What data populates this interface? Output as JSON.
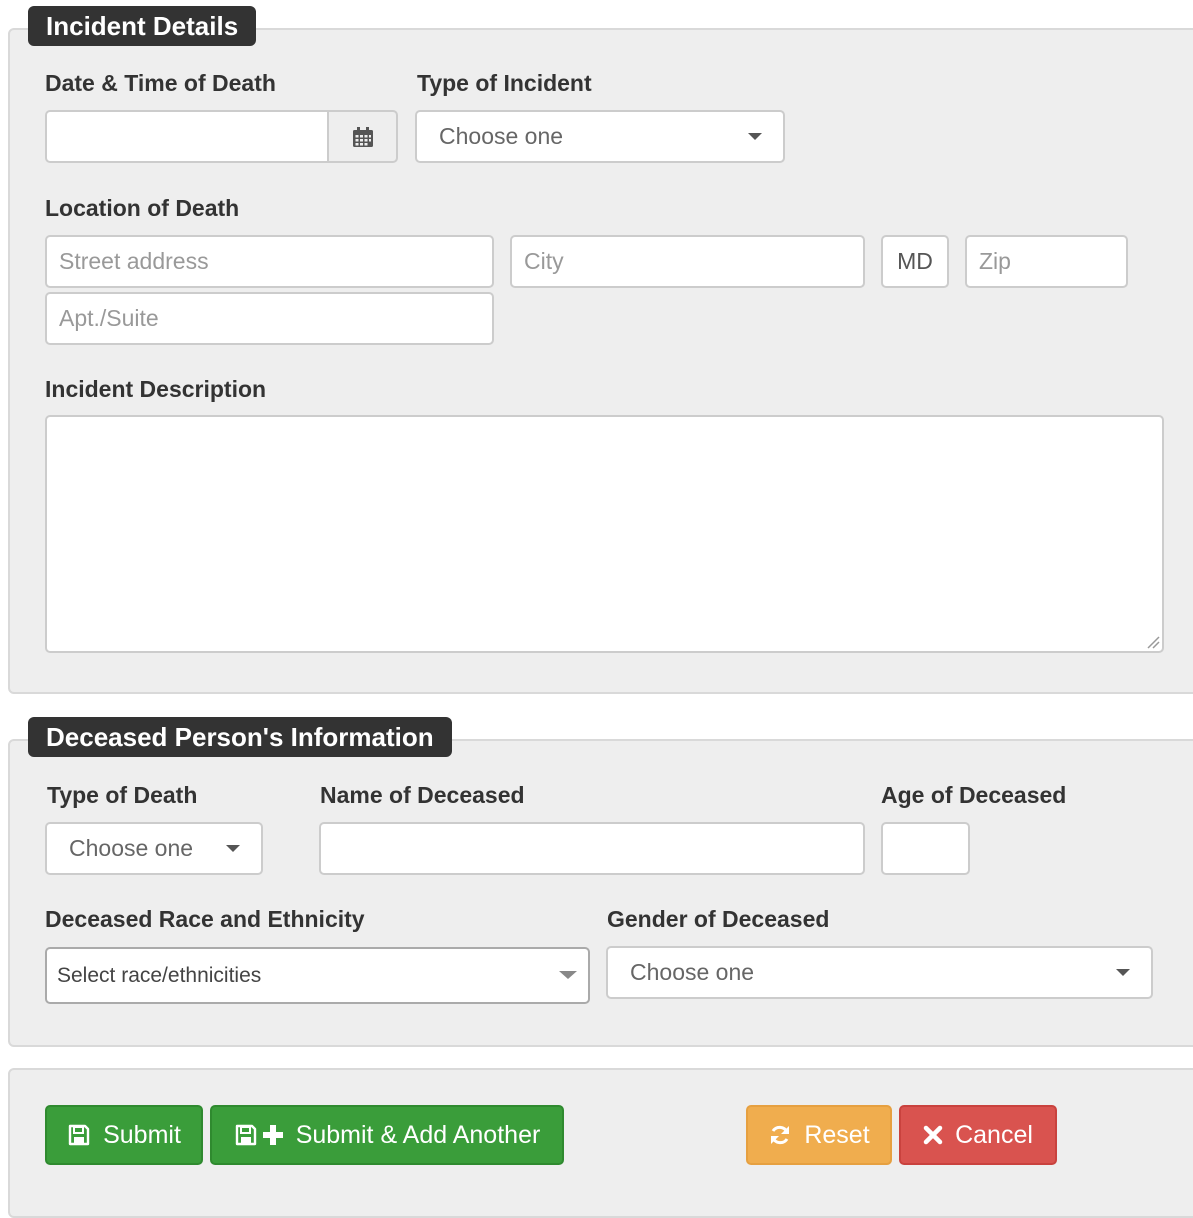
{
  "incident": {
    "legend": "Incident Details",
    "date_label": "Date & Time of Death",
    "date_value": "",
    "type_label": "Type of Incident",
    "type_value": "Choose one",
    "location_label": "Location of Death",
    "street_placeholder": "Street address",
    "city_placeholder": "City",
    "state_value": "MD",
    "zip_placeholder": "Zip",
    "apt_placeholder": "Apt./Suite",
    "description_label": "Incident Description",
    "description_value": ""
  },
  "deceased": {
    "legend": "Deceased Person's Information",
    "type_label": "Type of Death",
    "type_value": "Choose one",
    "name_label": "Name of Deceased",
    "name_value": "",
    "age_label": "Age of Deceased",
    "age_value": "",
    "race_label": "Deceased Race and Ethnicity",
    "race_placeholder": "Select race/ethnicities",
    "gender_label": "Gender of Deceased",
    "gender_value": "Choose one"
  },
  "actions": {
    "submit_label": "Submit",
    "submit_add_label": "Submit & Add Another",
    "reset_label": "Reset",
    "cancel_label": "Cancel"
  },
  "icons": {
    "calendar": "calendar-icon",
    "save": "floppy-disk-icon",
    "plus": "plus-icon",
    "refresh": "refresh-icon",
    "close": "close-icon",
    "caret": "chevron-down-icon"
  },
  "colors": {
    "legend_bg": "#333333",
    "fieldset_bg": "#eeeeee",
    "success": "#3a9d3a",
    "warning": "#f0ad4e",
    "danger": "#d9534f"
  }
}
